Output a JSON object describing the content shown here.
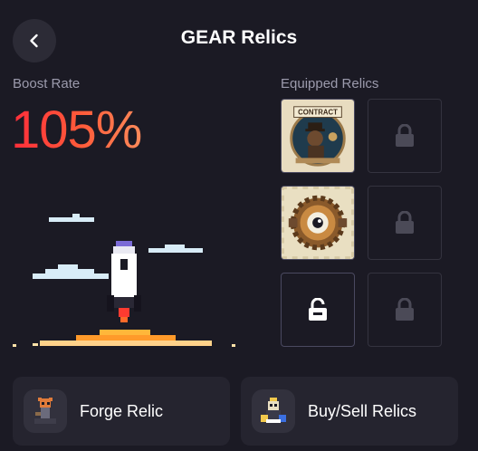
{
  "header": {
    "title": "GEAR Relics",
    "back_icon": "chevron-left-icon"
  },
  "boost": {
    "label": "Boost Rate",
    "value": "105%"
  },
  "equipped": {
    "label": "Equipped Relics",
    "slots": [
      {
        "state": "filled",
        "relic": "contract-relic",
        "text": "CONTRACT"
      },
      {
        "state": "locked",
        "icon": "lock-icon"
      },
      {
        "state": "filled",
        "relic": "gear-eye-relic"
      },
      {
        "state": "locked",
        "icon": "lock-icon"
      },
      {
        "state": "unlocked",
        "icon": "unlock-icon"
      },
      {
        "state": "locked",
        "icon": "lock-icon"
      }
    ]
  },
  "actions": {
    "forge_label": "Forge Relic",
    "trade_label": "Buy/Sell Relics"
  },
  "colors": {
    "background": "#1b1a24",
    "card": "#25242f",
    "boost_gradient_start": "#ff2d3a",
    "boost_gradient_end": "#ff8a5a"
  }
}
